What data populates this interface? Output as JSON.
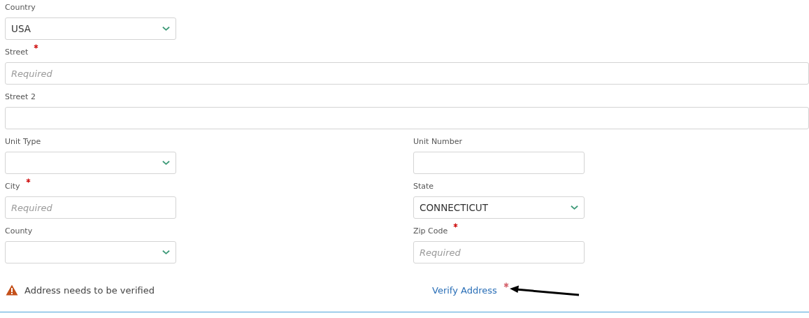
{
  "rows": [
    [
      {
        "kind": "select",
        "label": "Country",
        "value": "USA",
        "required": false
      }
    ],
    [
      {
        "kind": "text",
        "label": "Street",
        "placeholder": "Required",
        "required": true
      }
    ],
    [
      {
        "kind": "text",
        "label": "Street 2",
        "required": false
      }
    ],
    [
      {
        "kind": "select",
        "label": "Unit Type",
        "required": false
      },
      {
        "kind": "text",
        "label": "Unit Number",
        "required": false
      }
    ],
    [
      {
        "kind": "text",
        "label": "City",
        "placeholder": "Required",
        "required": true
      },
      {
        "kind": "select",
        "label": "State",
        "value": "CONNECTICUT",
        "required": false
      }
    ],
    [
      {
        "kind": "select",
        "label": "County",
        "required": false
      },
      {
        "kind": "text",
        "label": "Zip Code",
        "placeholder": "Required",
        "required": true
      }
    ]
  ],
  "verification": {
    "message": "Address needs to be verified",
    "link": "Verify Address",
    "required": true
  }
}
